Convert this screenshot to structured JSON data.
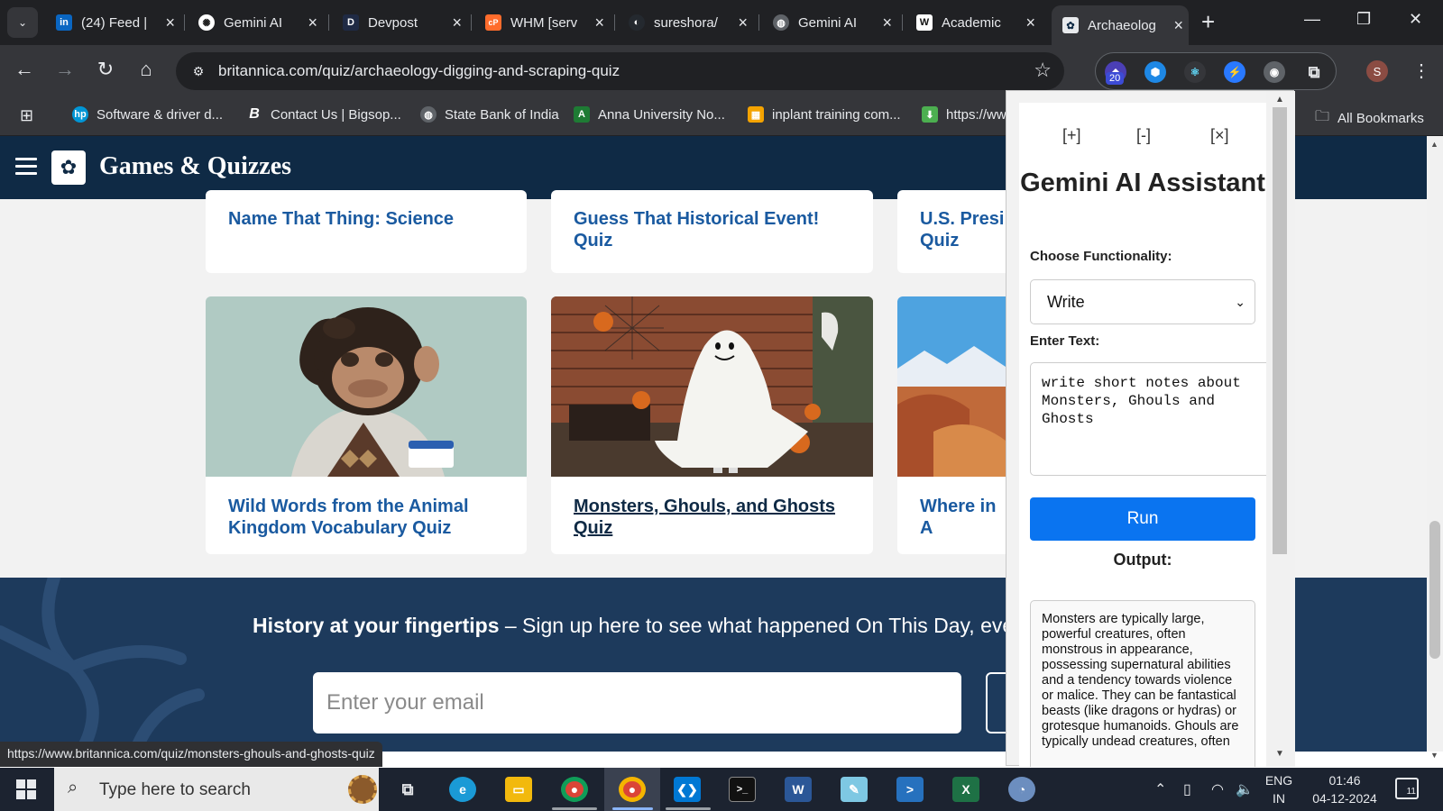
{
  "browser": {
    "tabs": [
      {
        "title": "(24) Feed |",
        "icon": "linkedin-icon",
        "color": "#0a66c2",
        "glyph": "in"
      },
      {
        "title": "Gemini AI",
        "icon": "openai-icon",
        "color": "#ffffff",
        "glyph": "✺"
      },
      {
        "title": "Devpost",
        "icon": "devpost-icon",
        "color": "#1f2a44",
        "glyph": "D"
      },
      {
        "title": "WHM [serv",
        "icon": "cpanel-icon",
        "color": "#ff6c2c",
        "glyph": "cP"
      },
      {
        "title": "sureshora/",
        "icon": "github-icon",
        "color": "#24292f",
        "glyph": "◐"
      },
      {
        "title": "Gemini AI",
        "icon": "globe-icon",
        "color": "#5f6368",
        "glyph": "◍"
      },
      {
        "title": "Academic",
        "icon": "wikipedia-icon",
        "color": "#ffffff",
        "glyph": "W"
      },
      {
        "title": "Archaeolog",
        "icon": "britannica-icon",
        "color": "#0f2a45",
        "glyph": "✿"
      }
    ],
    "url": "britannica.com/quiz/archaeology-digging-and-scraping-quiz",
    "bookmarks": [
      {
        "label": "Software & driver d...",
        "icon": "hp-icon",
        "color": "#0096d6"
      },
      {
        "label": "Contact Us | Bigsop...",
        "icon": "bigsop-icon",
        "color": "#35363a"
      },
      {
        "label": "State Bank of India",
        "icon": "globe-icon",
        "color": "#5f6368"
      },
      {
        "label": "Anna University No...",
        "icon": "anna-univ-icon",
        "color": "#1e7b34"
      },
      {
        "label": "inplant training com...",
        "icon": "inplant-icon",
        "color": "#f4a300"
      },
      {
        "label": "https://ww",
        "icon": "download-icon",
        "color": "#4caf50"
      }
    ],
    "all_bookmarks": "All Bookmarks",
    "profile_initial": "S",
    "extension_badge": "20",
    "status_link": "https://www.britannica.com/quiz/monsters-ghouls-and-ghosts-quiz"
  },
  "site": {
    "title": "Games & Quizzes",
    "top_cards": [
      "Name That Thing: Science",
      "Guess That Historical Event! Quiz",
      "U.S. Presi Quiz"
    ],
    "cards": [
      {
        "title": "Wild Words from the Animal Kingdom Vocabulary Quiz",
        "image": "chimpanzee-photo"
      },
      {
        "title": "Monsters, Ghouls, and Ghosts Quiz",
        "image": "ghost-costume-photo"
      },
      {
        "title": "Where in A",
        "image": "desert-canyon-photo"
      }
    ],
    "footer_bold": "History at your fingertips",
    "footer_text": " – Sign up here to see what happened On This Day, every",
    "email_placeholder": "Enter your email"
  },
  "gemini": {
    "controls": {
      "expand": "[+]",
      "collapse": "[-]",
      "close": "[×]"
    },
    "title": "Gemini AI Assistant",
    "functionality_label": "Choose Functionality:",
    "functionality_value": "Write",
    "text_label": "Enter Text:",
    "text_value": "write short notes about Monsters, Ghouls and Ghosts",
    "run_label": "Run",
    "output_label": "Output:",
    "output_text": "Monsters are typically large, powerful creatures, often monstrous in appearance, possessing supernatural abilities and a tendency towards violence or malice. They can be fantastical beasts (like dragons or hydras) or grotesque humanoids. Ghouls are typically undead creatures, often"
  },
  "taskbar": {
    "search_placeholder": "Type here to search",
    "language": "ENG",
    "region": "IN",
    "time": "01:46",
    "date": "04-12-2024",
    "notification_count": "11"
  }
}
